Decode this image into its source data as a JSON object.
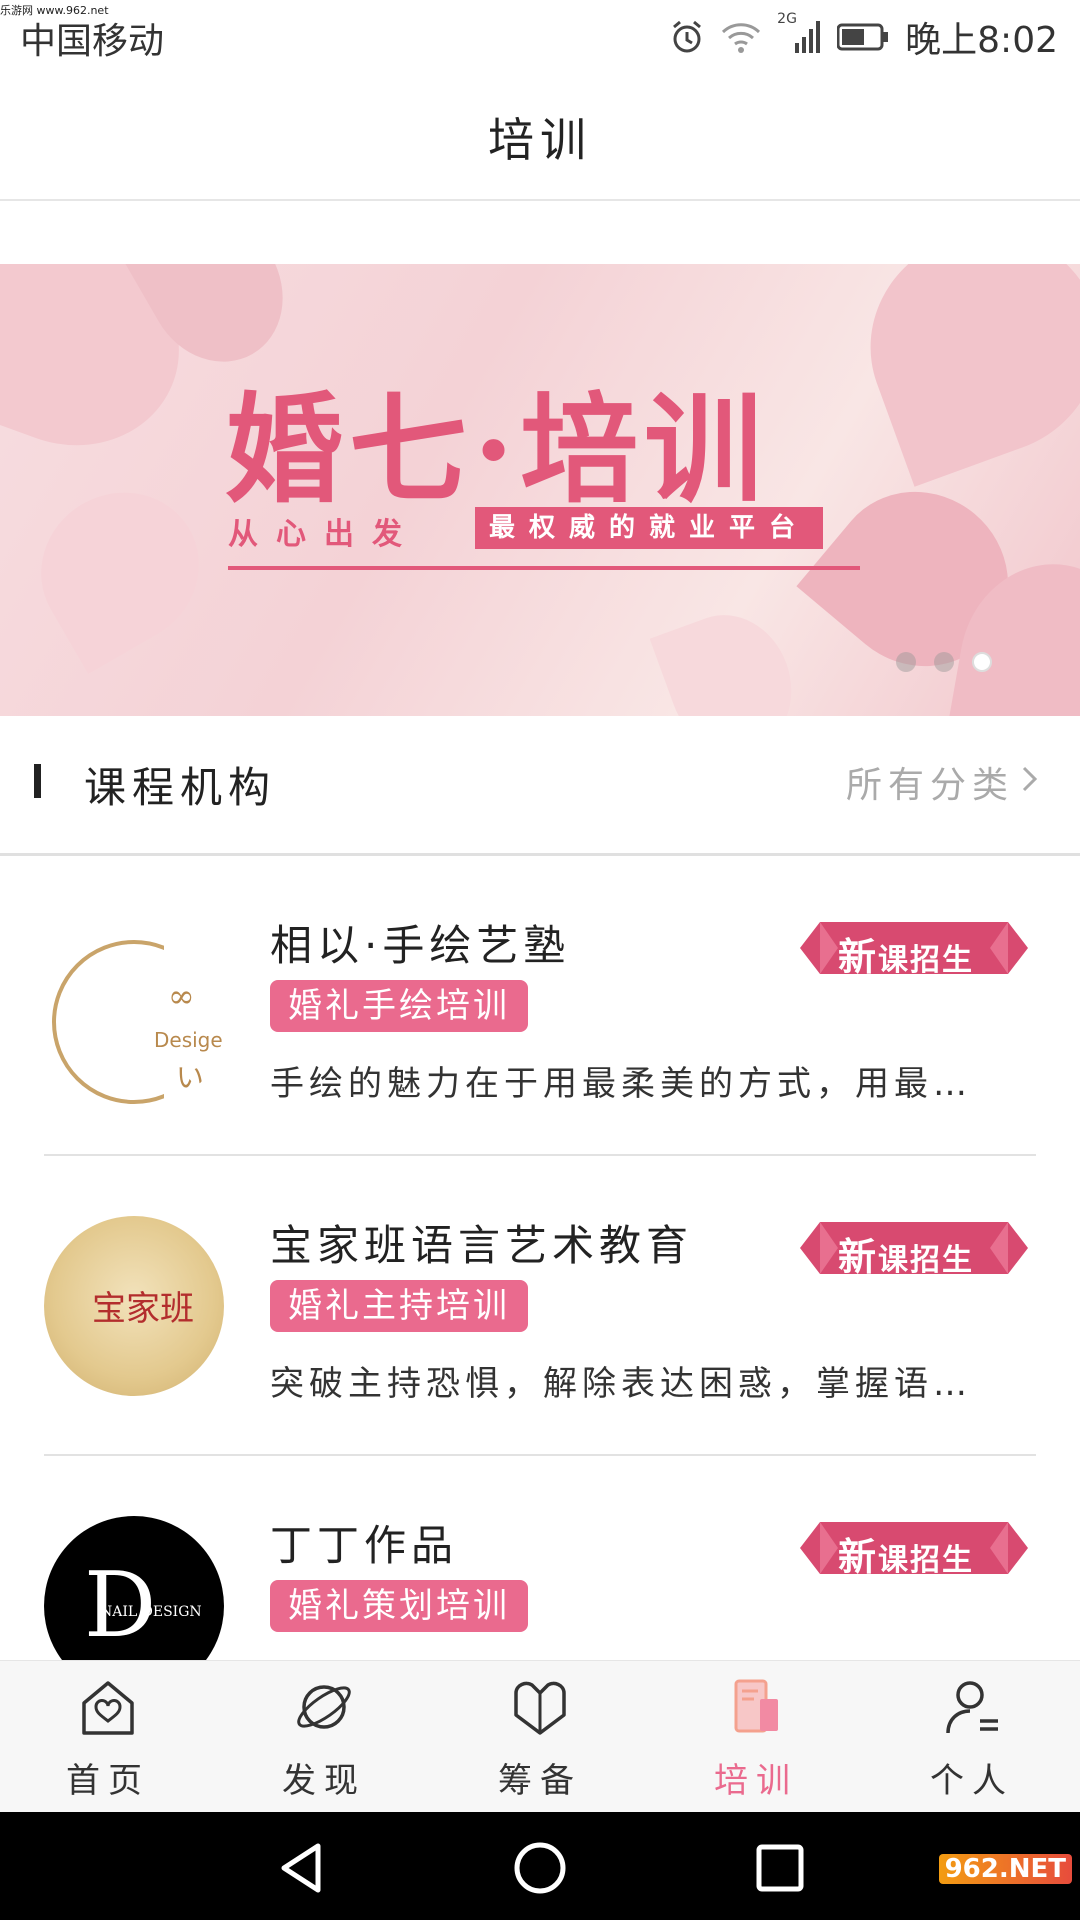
{
  "watermark_top": "乐游网 www.962.net",
  "status_bar": {
    "carrier": "中国移动",
    "network": "2G",
    "time": "晚上8:02"
  },
  "header": {
    "title": "培训"
  },
  "banner": {
    "title": "婚七·培训",
    "subtitle": "从心出发",
    "tag": "最权威的就业平台",
    "page_count": 3,
    "active_page": 3
  },
  "section": {
    "title": "课程机构",
    "link": "所有分类"
  },
  "badge_label": {
    "big": "新",
    "rest": "课招生"
  },
  "courses": [
    {
      "name": "相以·手绘艺塾",
      "tag": "婚礼手绘培训",
      "desc": "手绘的魅力在于用最柔美的方式，用最…",
      "logo_text": "Desige"
    },
    {
      "name": "宝家班语言艺术教育",
      "tag": "婚礼主持培训",
      "desc": "突破主持恐惧，解除表达困惑，掌握语…",
      "logo_text": "宝家班"
    },
    {
      "name": "丁丁作品",
      "tag": "婚礼策划培训",
      "desc": "",
      "logo_text": "NAIL DESIGN"
    }
  ],
  "tabs": [
    {
      "label": "首页",
      "icon": "home-icon"
    },
    {
      "label": "发现",
      "icon": "planet-icon"
    },
    {
      "label": "筹备",
      "icon": "heart-book-icon"
    },
    {
      "label": "培训",
      "icon": "training-icon"
    },
    {
      "label": "个人",
      "icon": "person-icon"
    }
  ],
  "active_tab": "培训",
  "colors": {
    "accent": "#ea6a8e",
    "banner_pink": "#e2587a",
    "badge": "#d84a70"
  },
  "corner_watermark": "962.NET"
}
